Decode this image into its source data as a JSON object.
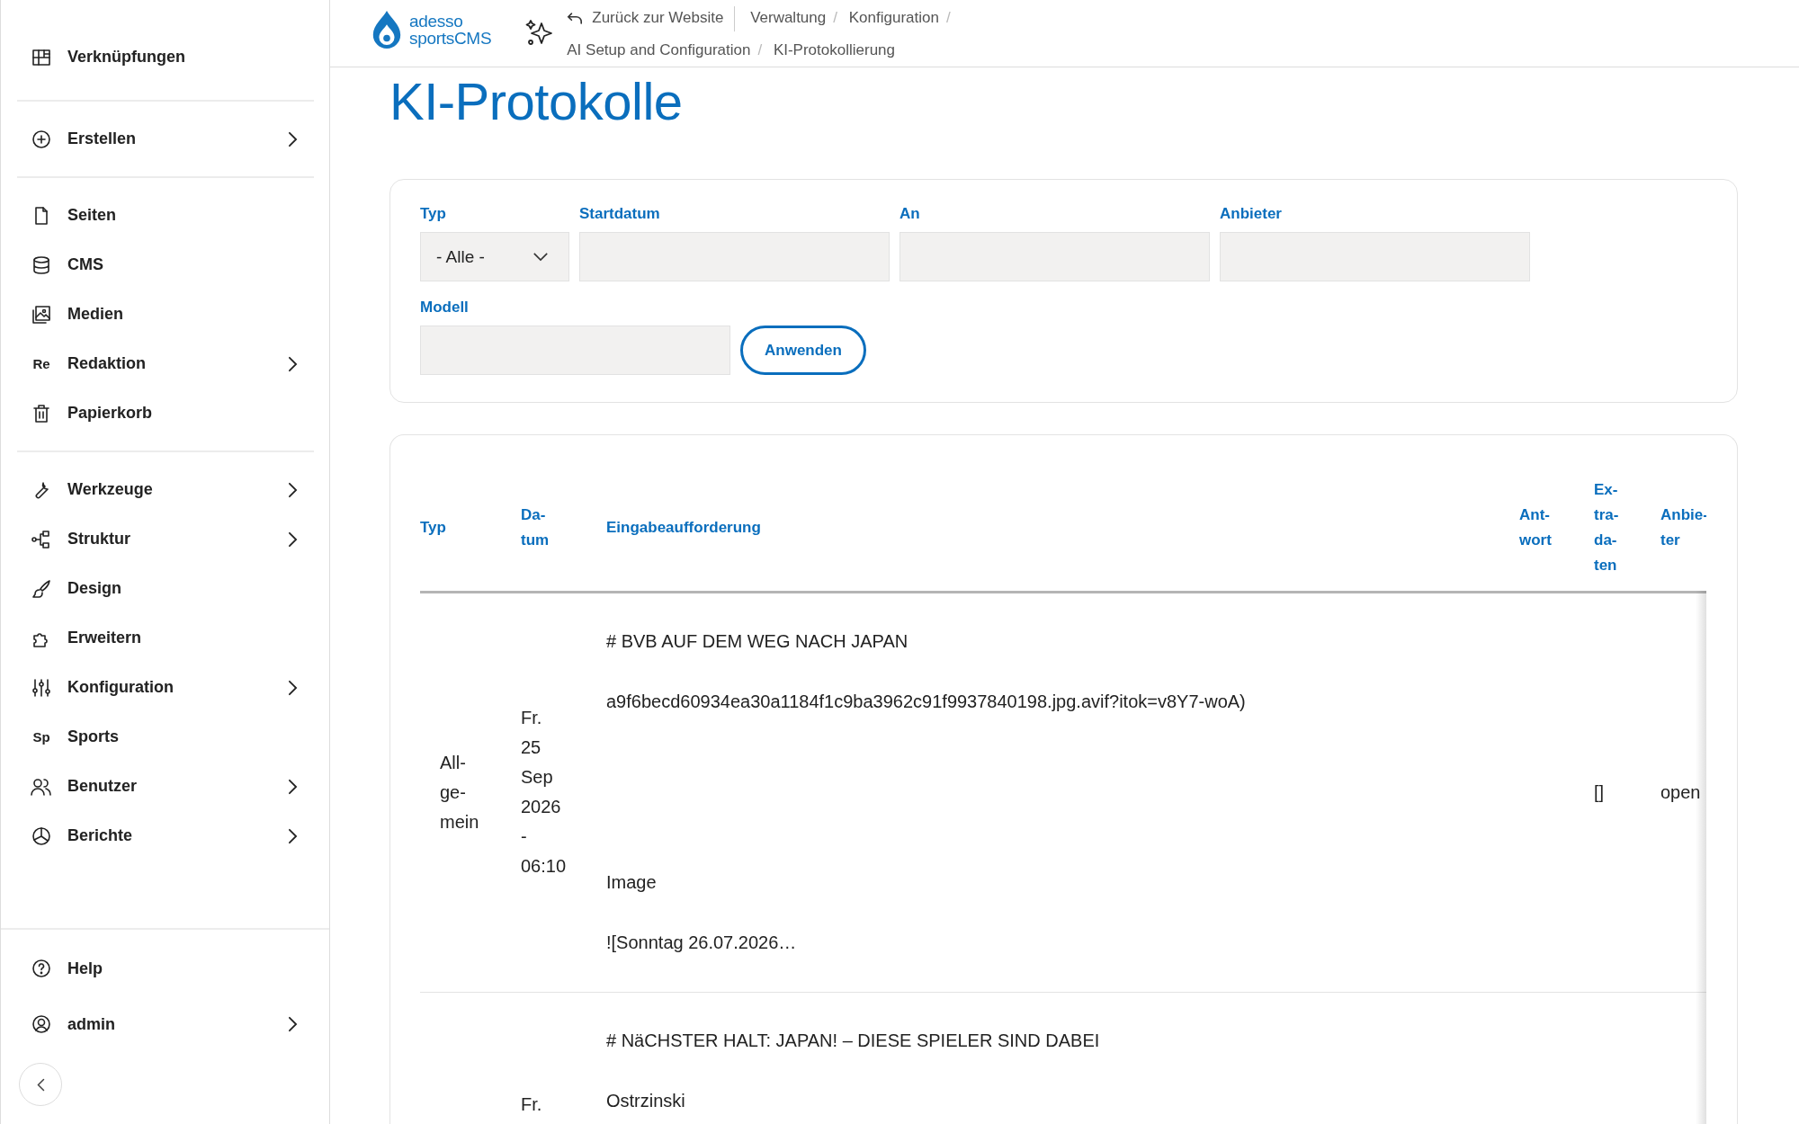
{
  "sidebar": {
    "groups": [
      [
        {
          "label": "Verknüpfungen",
          "has_submenu": false
        }
      ],
      [
        {
          "label": "Erstellen",
          "has_submenu": true
        }
      ],
      [
        {
          "label": "Seiten",
          "has_submenu": false
        },
        {
          "label": "CMS",
          "has_submenu": false
        },
        {
          "label": "Medien",
          "has_submenu": false
        },
        {
          "label": "Redaktion",
          "abbr": "Re",
          "has_submenu": true
        },
        {
          "label": "Papierkorb",
          "has_submenu": false
        }
      ],
      [
        {
          "label": "Werkzeuge",
          "has_submenu": true
        },
        {
          "label": "Struktur",
          "has_submenu": true
        },
        {
          "label": "Design",
          "has_submenu": false
        },
        {
          "label": "Erweitern",
          "has_submenu": false
        },
        {
          "label": "Konfiguration",
          "has_submenu": true
        },
        {
          "label": "Sports",
          "abbr": "Sp",
          "has_submenu": false
        },
        {
          "label": "Benutzer",
          "has_submenu": true
        },
        {
          "label": "Berichte",
          "has_submenu": true
        }
      ]
    ],
    "footer": [
      {
        "label": "Help",
        "has_submenu": false
      },
      {
        "label": "admin",
        "has_submenu": true
      }
    ]
  },
  "header": {
    "logo": {
      "line_1": "adesso",
      "line_2": "sportsCMS"
    },
    "back_link": "Zurück zur Website",
    "breadcrumbs": [
      "Verwaltung",
      "Konfiguration",
      "AI Setup and Configuration",
      "KI-Protokollierung"
    ],
    "separator": "/"
  },
  "page_title": "KI-Protokolle",
  "filters": {
    "fields": [
      {
        "label": "Typ",
        "kind": "select",
        "value": "- Alle -"
      },
      {
        "label": "Startdatum",
        "kind": "text"
      },
      {
        "label": "An",
        "kind": "text"
      },
      {
        "label": "Anbieter",
        "kind": "text"
      },
      {
        "label": "Modell",
        "kind": "text"
      }
    ],
    "apply_button": "Anwenden"
  },
  "table": {
    "columns": [
      "Typ",
      "Da-\ntum",
      "Eingabeaufforderung",
      "Ant-\nwort",
      "Ex-\ntra-\nda-\nten",
      "Anbie-\nter"
    ],
    "rows": [
      {
        "type": "All-\nge-\nmein",
        "date": "Fr.\n25\nSep\n2026\n-\n06:10",
        "prompt": "# BVB AUF DEM WEG NACH JAPAN\n\na9f6becd60934ea30a1184f1c9ba3962c91f9937840198.jpg.avif?itok=v8Y7-woA)\n\n\n\n\n\nImage\n\n![Sonntag 26.07.2026…",
        "extra_data": "[]",
        "provider": "open"
      },
      {
        "date": "Fr.",
        "prompt": "# NäCHSTER HALT: JAPAN! – DIESE SPIELER SIND DABEI\n\nOstrzinski"
      }
    ]
  }
}
